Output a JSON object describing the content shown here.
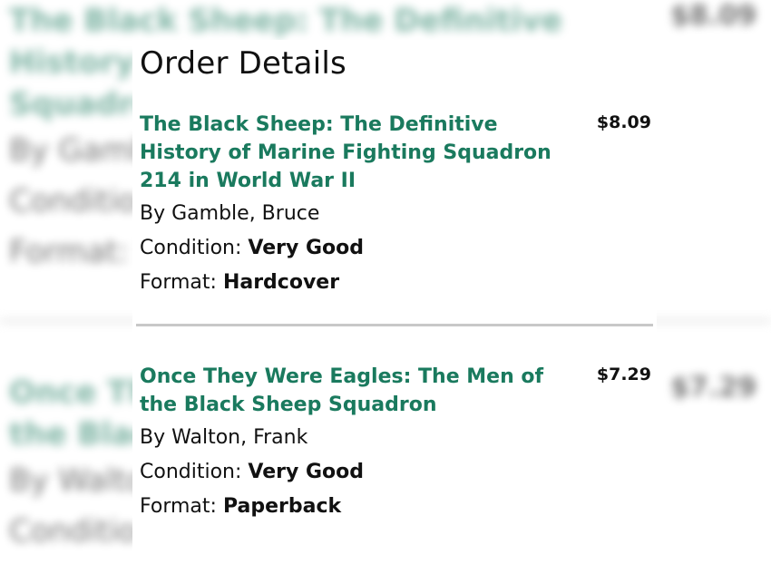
{
  "background_items": [
    {
      "title": "The Black Sheep: The Definitive History of Marine Fighting Squadron 214 in World War II",
      "price": "$8.09",
      "author_prefix": "By",
      "author": "Gamble, Bruce",
      "condition_label": "Condition:",
      "condition": "Very Good",
      "format_label": "Format:",
      "format": "Hardcover"
    },
    {
      "title": "Once They Were Eagles: The Men of the Black Sheep Squadron",
      "price": "$7.29",
      "author_prefix": "By",
      "author": "Walton, Frank",
      "condition_label": "Condition:",
      "condition": "Very Good"
    }
  ],
  "panel": {
    "title": "Order Details",
    "items": [
      {
        "title": "The Black Sheep: The Definitive History of Marine Fighting Squadron 214 in World War II",
        "price": "$8.09",
        "author_prefix": "By",
        "author": "Gamble, Bruce",
        "condition_label": "Condition:",
        "condition": "Very Good",
        "format_label": "Format:",
        "format": "Hardcover"
      },
      {
        "title": "Once They Were Eagles: The Men of the Black Sheep Squadron",
        "price": "$7.29",
        "author_prefix": "By",
        "author": "Walton, Frank",
        "condition_label": "Condition:",
        "condition": "Very Good",
        "format_label": "Format:",
        "format": "Paperback"
      }
    ]
  },
  "colors": {
    "title_green": "#1a7a5e",
    "separator": "#c8c8c8"
  }
}
